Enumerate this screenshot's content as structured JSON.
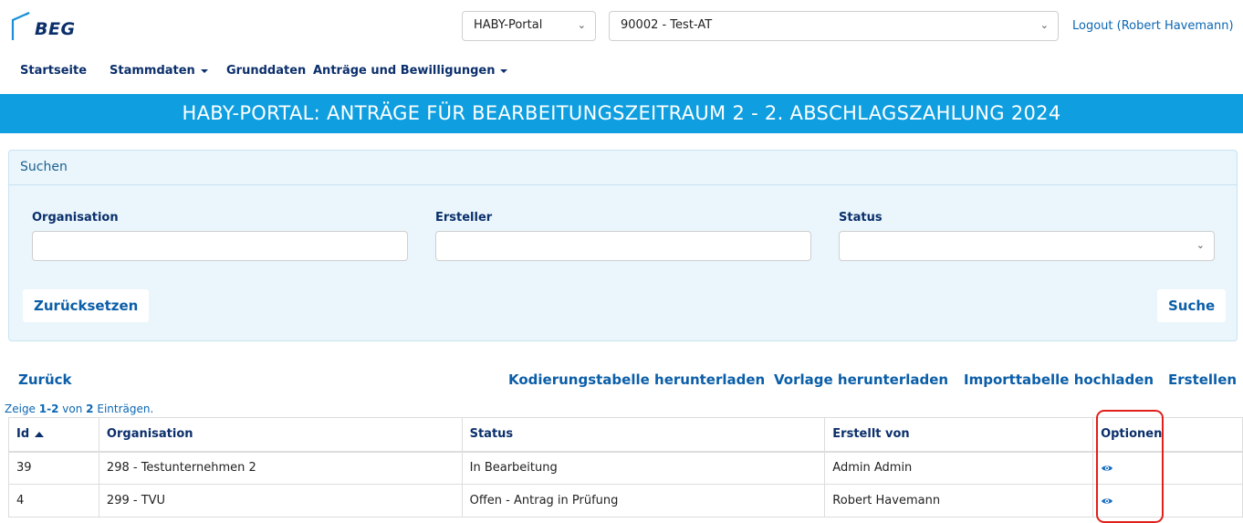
{
  "header": {
    "logo_text": "BEG",
    "portal_select": "HABY-Portal",
    "org_select": "90002 - Test-AT",
    "logout": "Logout (Robert Havemann)"
  },
  "nav": {
    "items": [
      "Startseite",
      "Stammdaten",
      "Grunddaten",
      "Anträge und Bewilligungen"
    ]
  },
  "banner": {
    "title": "HABY-PORTAL: ANTRÄGE FÜR BEARBEITUNGSZEITRAUM 2 - 2. ABSCHLAGSZAHLUNG 2024"
  },
  "search": {
    "title": "Suchen",
    "fields": {
      "organisation": {
        "label": "Organisation",
        "value": ""
      },
      "ersteller": {
        "label": "Ersteller",
        "value": ""
      },
      "status": {
        "label": "Status",
        "value": ""
      }
    },
    "reset_label": "Zurücksetzen",
    "search_label": "Suche"
  },
  "actions": {
    "back": "Zurück",
    "download_coding": "Kodierungstabelle herunterladen",
    "download_template": "Vorlage herunterladen",
    "upload_import": "Importtabelle hochladen",
    "create": "Erstellen"
  },
  "summary": {
    "prefix": "Zeige",
    "range": "1-2",
    "middle": "von",
    "total": "2",
    "suffix": "Einträgen."
  },
  "table": {
    "columns": [
      "Id",
      "Organisation",
      "Status",
      "Erstellt von",
      "Optionen"
    ],
    "rows": [
      {
        "id": "39",
        "organisation": "298 - Testunternehmen 2",
        "status": "In Bearbeitung",
        "created_by": "Admin Admin",
        "option_icon": "eye-icon"
      },
      {
        "id": "4",
        "organisation": "299 - TVU",
        "status": "Offen - Antrag in Prüfung",
        "created_by": "Robert Havemann",
        "option_icon": "eye-icon"
      }
    ]
  },
  "colors": {
    "brand_dark": "#0b2f6b",
    "link_blue": "#0b5ea8",
    "banner_bg": "#0f9fe0",
    "panel_bg": "#eaf6fc",
    "highlight": "#e0201b"
  }
}
